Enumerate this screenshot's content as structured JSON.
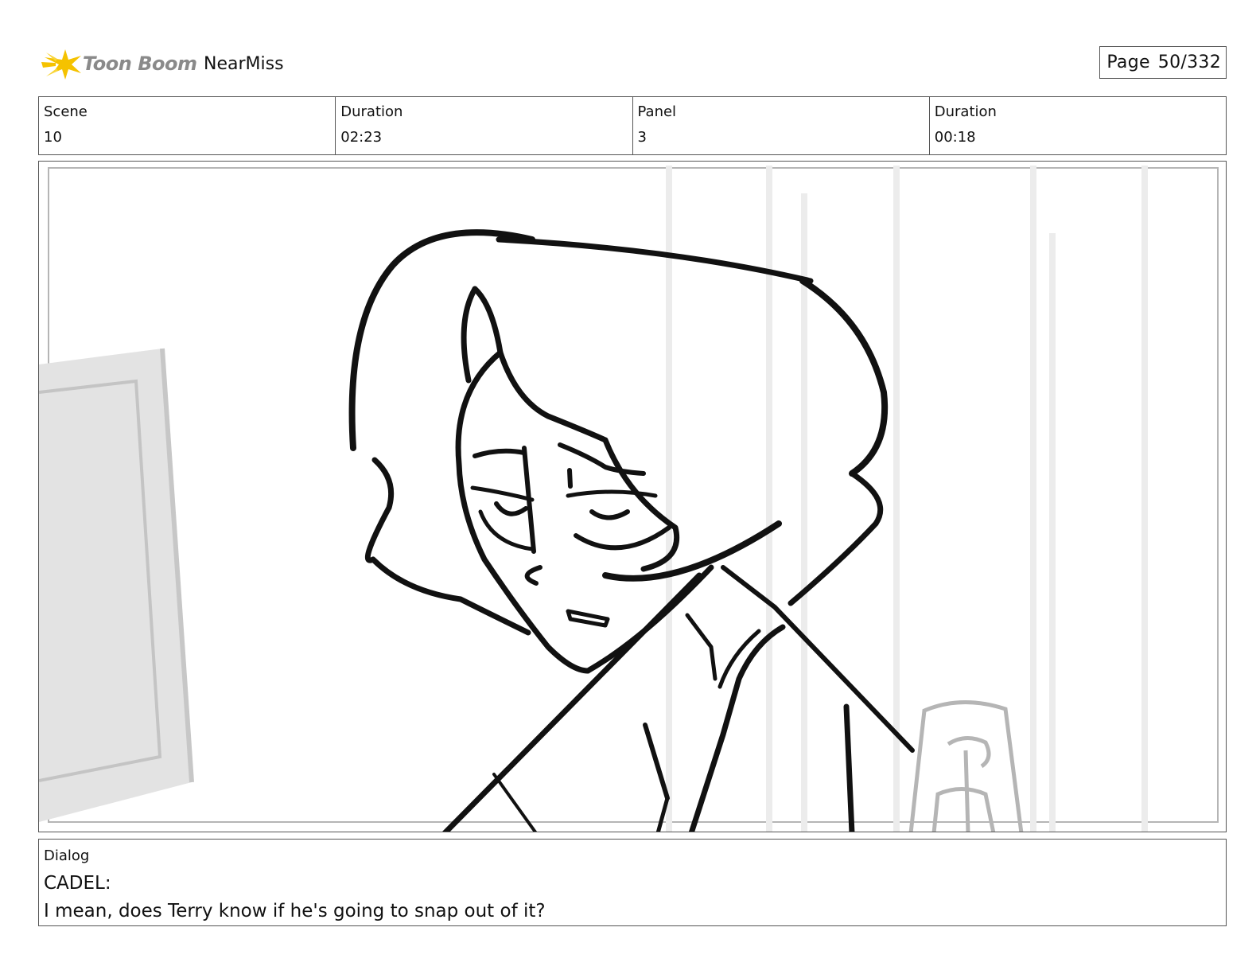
{
  "header": {
    "logo_text": "Toon Boom",
    "project_name": "NearMiss",
    "page_label": "Page",
    "page_number": "50/332"
  },
  "info": {
    "scene_label": "Scene",
    "scene_value": "10",
    "scene_duration_label": "Duration",
    "scene_duration_value": "02:23",
    "panel_label": "Panel",
    "panel_value": "3",
    "panel_duration_label": "Duration",
    "panel_duration_value": "00:18"
  },
  "dialog": {
    "label": "Dialog",
    "speaker": "CADEL:",
    "line": "I mean, does Terry know if he's going to snap out of it?"
  },
  "colors": {
    "logo_star": "#f5c200",
    "border": "#555555",
    "sketch_gray": "#e2e2e2"
  }
}
